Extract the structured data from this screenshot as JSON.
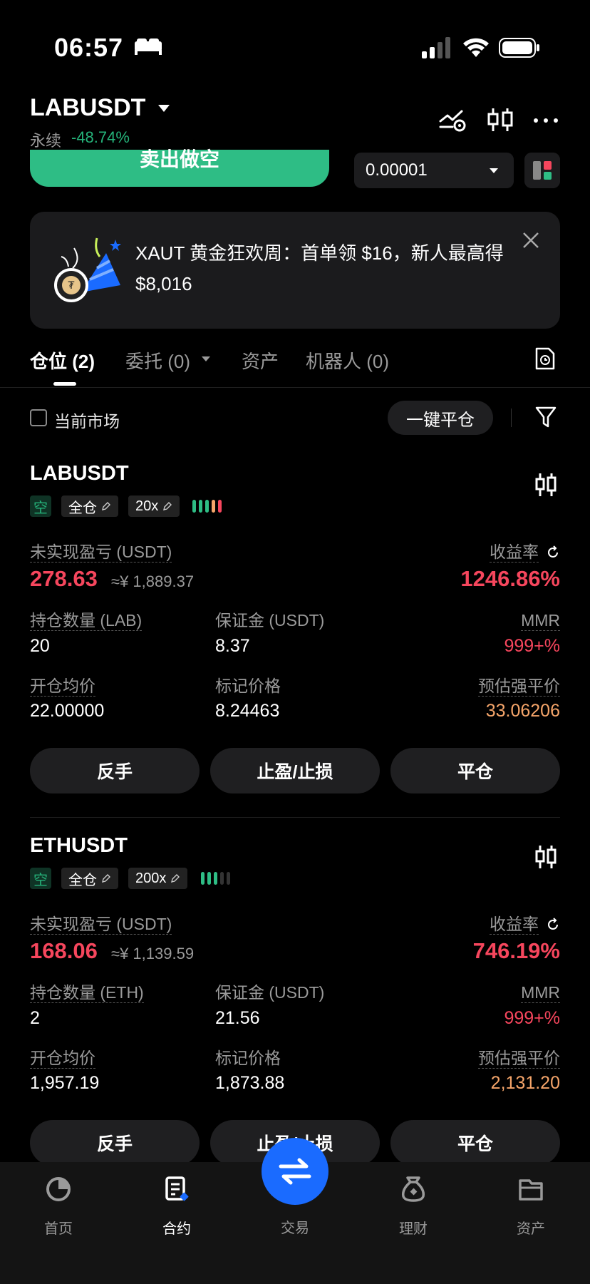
{
  "status_bar": {
    "time": "06:57"
  },
  "header": {
    "pair": "LABUSDT",
    "contract_type": "永续",
    "change": "-48.74%"
  },
  "trade": {
    "sell_label": "卖出做空",
    "qty_value": "0.00001"
  },
  "banner": {
    "text": "XAUT 黄金狂欢周：首单领 $16，新人最高得 $8,016"
  },
  "tabs": [
    {
      "label": "仓位 (2)"
    },
    {
      "label": "委托 (0)"
    },
    {
      "label": "资产"
    },
    {
      "label": "机器人 (0)"
    }
  ],
  "filter": {
    "current_market_label": "当前市场",
    "close_all_label": "一键平仓"
  },
  "positions": [
    {
      "symbol": "LABUSDT",
      "side": "空",
      "margin_mode": "全仓",
      "leverage": "20x",
      "risk_level": 5,
      "unrealized_pnl_label": "未实现盈亏 (USDT)",
      "unrealized_pnl": "278.63",
      "unrealized_pnl_cny": "≈¥ 1,889.37",
      "roi_label": "收益率",
      "roi": "1246.86%",
      "size_label": "持仓数量 (LAB)",
      "size": "20",
      "margin_label": "保证金 (USDT)",
      "margin": "8.37",
      "mmr_label": "MMR",
      "mmr": "999+%",
      "entry_label": "开仓均价",
      "entry": "22.00000",
      "mark_label": "标记价格",
      "mark": "8.24463",
      "liq_label": "预估强平价",
      "liq": "33.06206",
      "btn_reverse": "反手",
      "btn_tpsl": "止盈/止损",
      "btn_close": "平仓"
    },
    {
      "symbol": "ETHUSDT",
      "side": "空",
      "margin_mode": "全仓",
      "leverage": "200x",
      "risk_level": 3,
      "unrealized_pnl_label": "未实现盈亏 (USDT)",
      "unrealized_pnl": "168.06",
      "unrealized_pnl_cny": "≈¥ 1,139.59",
      "roi_label": "收益率",
      "roi": "746.19%",
      "size_label": "持仓数量 (ETH)",
      "size": "2",
      "margin_label": "保证金 (USDT)",
      "margin": "21.56",
      "mmr_label": "MMR",
      "mmr": "999+%",
      "entry_label": "开仓均价",
      "entry": "1,957.19",
      "mark_label": "标记价格",
      "mark": "1,873.88",
      "liq_label": "预估强平价",
      "liq": "2,131.20",
      "btn_reverse": "反手",
      "btn_tpsl": "止盈/止损",
      "btn_close": "平仓"
    }
  ],
  "bottom_nav": [
    {
      "label": "首页",
      "icon": "home-icon"
    },
    {
      "label": "合约",
      "icon": "contract-icon"
    },
    {
      "label": "交易",
      "icon": "swap-icon"
    },
    {
      "label": "理财",
      "icon": "earn-icon"
    },
    {
      "label": "资产",
      "icon": "wallet-icon"
    }
  ],
  "colors": {
    "buy_green": "#2ebd85",
    "sell_red": "#f6465d",
    "liq_orange": "#f5a56a",
    "accent_blue": "#1a6bff"
  }
}
